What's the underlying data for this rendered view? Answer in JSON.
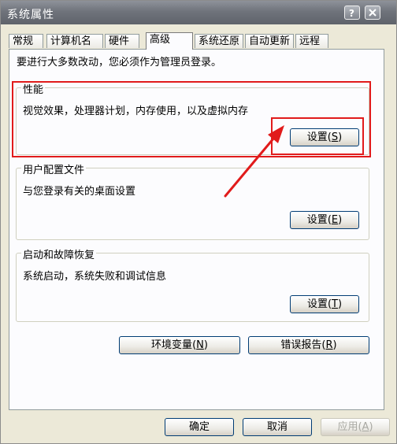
{
  "window": {
    "title": "系统属性",
    "title_color": "#ffffff",
    "accent_red": "#e11b1b"
  },
  "tabs": [
    {
      "label": "常规"
    },
    {
      "label": "计算机名"
    },
    {
      "label": "硬件"
    },
    {
      "label": "高级",
      "active": true
    },
    {
      "label": "系统还原"
    },
    {
      "label": "自动更新"
    },
    {
      "label": "远程"
    }
  ],
  "notice": "要进行大多数改动，您必须作为管理员登录。",
  "performance": {
    "title": "性能",
    "description": "视觉效果，处理器计划，内存使用，以及虚拟内存",
    "button_text": "设置",
    "button_key": "S"
  },
  "user_profiles": {
    "title": "用户配置文件",
    "description": "与您登录有关的桌面设置",
    "button_text": "设置",
    "button_key": "E"
  },
  "startup_recovery": {
    "title": "启动和故障恢复",
    "description": "系统启动，系统失败和调试信息",
    "button_text": "设置",
    "button_key": "T"
  },
  "env_button": {
    "text": "环境变量",
    "key": "N"
  },
  "error_button": {
    "text": "错误报告",
    "key": "R"
  },
  "footer": {
    "ok": "确定",
    "cancel": "取消",
    "apply_text": "应用",
    "apply_key": "A"
  }
}
